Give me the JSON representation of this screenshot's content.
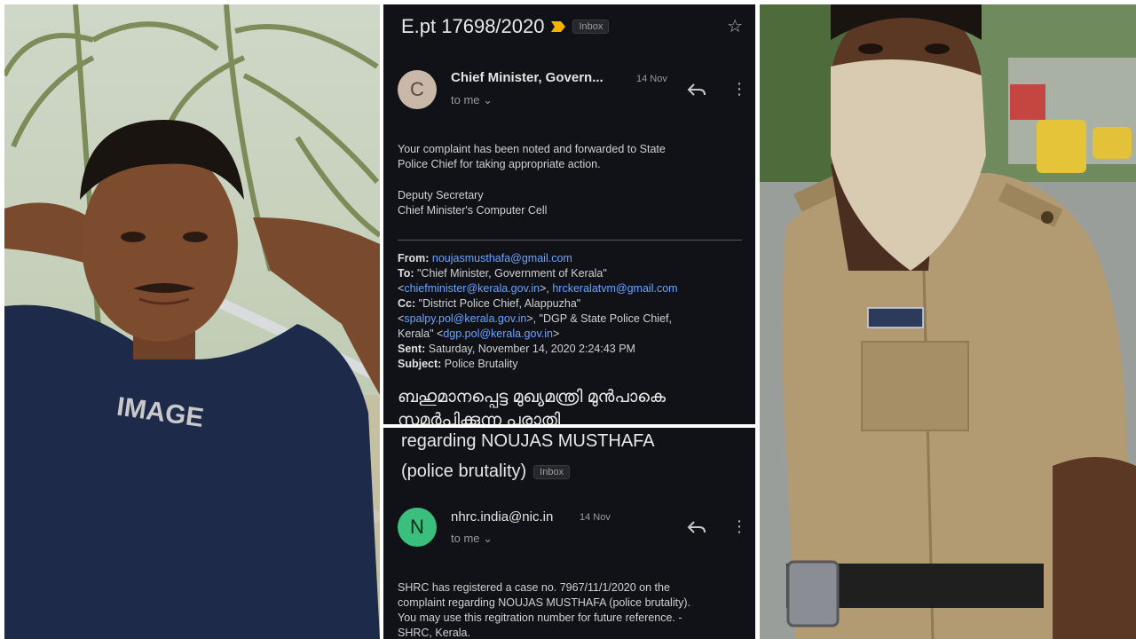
{
  "email_top": {
    "subject": "E.pt 17698/2020",
    "inbox_label": "Inbox",
    "sender_initial": "C",
    "sender_name": "Chief Minister, Govern...",
    "date": "14 Nov",
    "to_me": "to me",
    "body_line1": "Your complaint has been noted and forwarded to State",
    "body_line2": "Police Chief for taking appropriate action.",
    "sign_line1": "Deputy Secretary",
    "sign_line2": "Chief Minister's Computer Cell",
    "from_label": "From:",
    "from_value": "noujasmusthafa@gmail.com",
    "to_label": "To:",
    "to_name": "\"Chief Minister, Government of Kerala\"",
    "to_email1": "chiefminister@kerala.gov.in",
    "to_sep": ">, ",
    "to_email2": "hrckeralatvm@gmail.com",
    "cc_label": "Cc:",
    "cc_name1": "\"District Police Chief, Alappuzha\"",
    "cc_email1": "spalpy.pol@kerala.gov.in",
    "cc_name2": ">, \"DGP & State Police Chief,",
    "cc_name2b": "Kerala\" <",
    "cc_email2": "dgp.pol@kerala.gov.in",
    "sent_label": "Sent:",
    "sent_value": "Saturday, November 14, 2020 2:24:43 PM",
    "subject_label": "Subject:",
    "subject_value": "Police Brutality",
    "malayalam_line1": "ബഹുമാനപ്പെട്ട മുഖ്യമന്ത്രി മുൻപാകെ",
    "malayalam_line2": "സമർപ്പിക്കുന്ന പരാതി"
  },
  "email_bottom": {
    "subject_line1": "regarding NOUJAS MUSTHAFA",
    "subject_line2": "(police brutality)",
    "inbox_label": "Inbox",
    "sender_initial": "N",
    "sender_name": "nhrc.india@nic.in",
    "date": "14 Nov",
    "to_me": "to me",
    "body_line1": "SHRC has registered a case no. 7967/11/1/2020 on the",
    "body_line2": "complaint regarding NOUJAS MUSTHAFA (police brutality).",
    "body_line3": "You may use this regitration number for future reference. -",
    "body_line4": "SHRC, Kerala."
  },
  "photos": {
    "left_shirt_text": "IMAGE",
    "badge_text": "—"
  },
  "colors": {
    "email_bg": "#111217",
    "avatar_c": "#c9b8a8",
    "avatar_n": "#3bbf7c",
    "link": "#6aa3ff",
    "uniform": "#b29a72",
    "shirt": "#1d2a4a"
  }
}
